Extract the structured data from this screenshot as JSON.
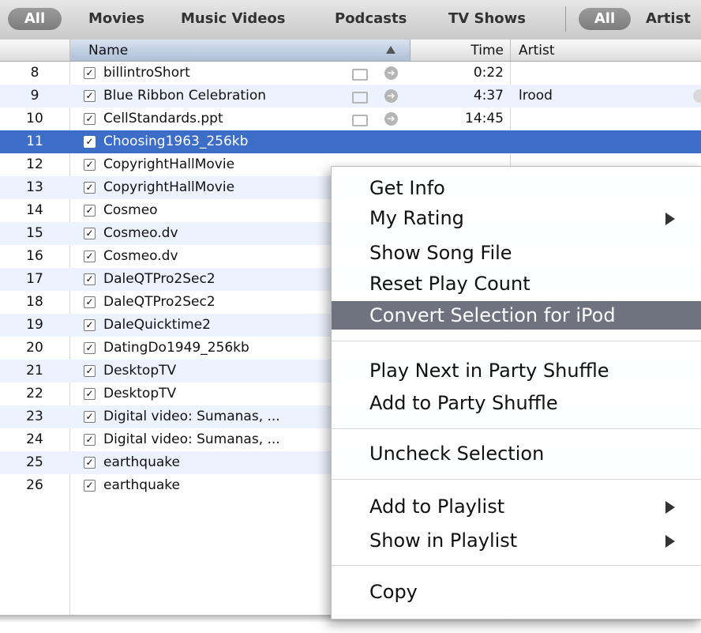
{
  "filter_bar": {
    "left_pill": "All",
    "categories": [
      "Movies",
      "Music Videos",
      "Podcasts",
      "TV Shows"
    ],
    "right_pill": "All",
    "right_label": "Artist"
  },
  "columns": {
    "name": "Name",
    "time": "Time",
    "artist": "Artist"
  },
  "rows": [
    {
      "num": "8",
      "name": "billintroShort",
      "time": "0:22",
      "artist": ""
    },
    {
      "num": "9",
      "name": "Blue Ribbon Celebration",
      "time": "4:37",
      "artist": "lrood"
    },
    {
      "num": "10",
      "name": "CellStandards.ppt",
      "time": "14:45",
      "artist": ""
    },
    {
      "num": "11",
      "name": "Choosing1963_256kb",
      "time": "",
      "artist": ""
    },
    {
      "num": "12",
      "name": "CopyrightHallMovie",
      "time": "",
      "artist": ""
    },
    {
      "num": "13",
      "name": "CopyrightHallMovie",
      "time": "",
      "artist": ""
    },
    {
      "num": "14",
      "name": "Cosmeo",
      "time": "",
      "artist": ""
    },
    {
      "num": "15",
      "name": "Cosmeo.dv",
      "time": "",
      "artist": ""
    },
    {
      "num": "16",
      "name": "Cosmeo.dv",
      "time": "",
      "artist": ""
    },
    {
      "num": "17",
      "name": "DaleQTPro2Sec2",
      "time": "",
      "artist": ""
    },
    {
      "num": "18",
      "name": "DaleQTPro2Sec2",
      "time": "",
      "artist": ""
    },
    {
      "num": "19",
      "name": "DaleQuicktime2",
      "time": "",
      "artist": ""
    },
    {
      "num": "20",
      "name": "DatingDo1949_256kb",
      "time": "",
      "artist": ""
    },
    {
      "num": "21",
      "name": "DesktopTV",
      "time": "",
      "artist": ""
    },
    {
      "num": "22",
      "name": "DesktopTV",
      "time": "",
      "artist": ""
    },
    {
      "num": "23",
      "name": "Digital video: Sumanas, ...",
      "time": "",
      "artist": ""
    },
    {
      "num": "24",
      "name": "Digital video: Sumanas, ...",
      "time": "",
      "artist": ""
    },
    {
      "num": "25",
      "name": "earthquake",
      "time": "",
      "artist": ""
    },
    {
      "num": "26",
      "name": "earthquake",
      "time": "",
      "artist": ""
    }
  ],
  "selected_row": "11",
  "context_menu": {
    "get_info": "Get Info",
    "my_rating": "My Rating",
    "show_song_file": "Show Song File",
    "reset_play_count": "Reset Play Count",
    "convert_selection": "Convert Selection for iPod",
    "play_next": "Play Next in Party Shuffle",
    "add_party": "Add to Party Shuffle",
    "uncheck": "Uncheck Selection",
    "add_playlist": "Add to Playlist",
    "show_playlist": "Show in Playlist",
    "copy": "Copy"
  },
  "colors": {
    "selection": "#3c6ec8",
    "menu_highlight": "#6f7380",
    "row_alt": "#edf3fe"
  }
}
